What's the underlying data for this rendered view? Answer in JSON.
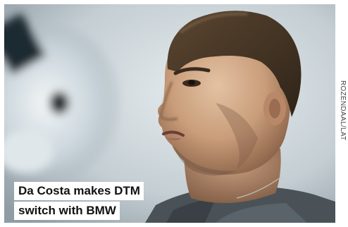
{
  "photo": {
    "description_icon": "portrait-photo",
    "credit": "ROZENDAAL/LAT"
  },
  "caption": {
    "line1": "Da Costa makes DTM",
    "line2": "switch with BMW"
  },
  "colors": {
    "background": "#ffffff",
    "caption_bg": "#ffffff",
    "caption_text": "#111111",
    "credit_text": "#444444"
  }
}
